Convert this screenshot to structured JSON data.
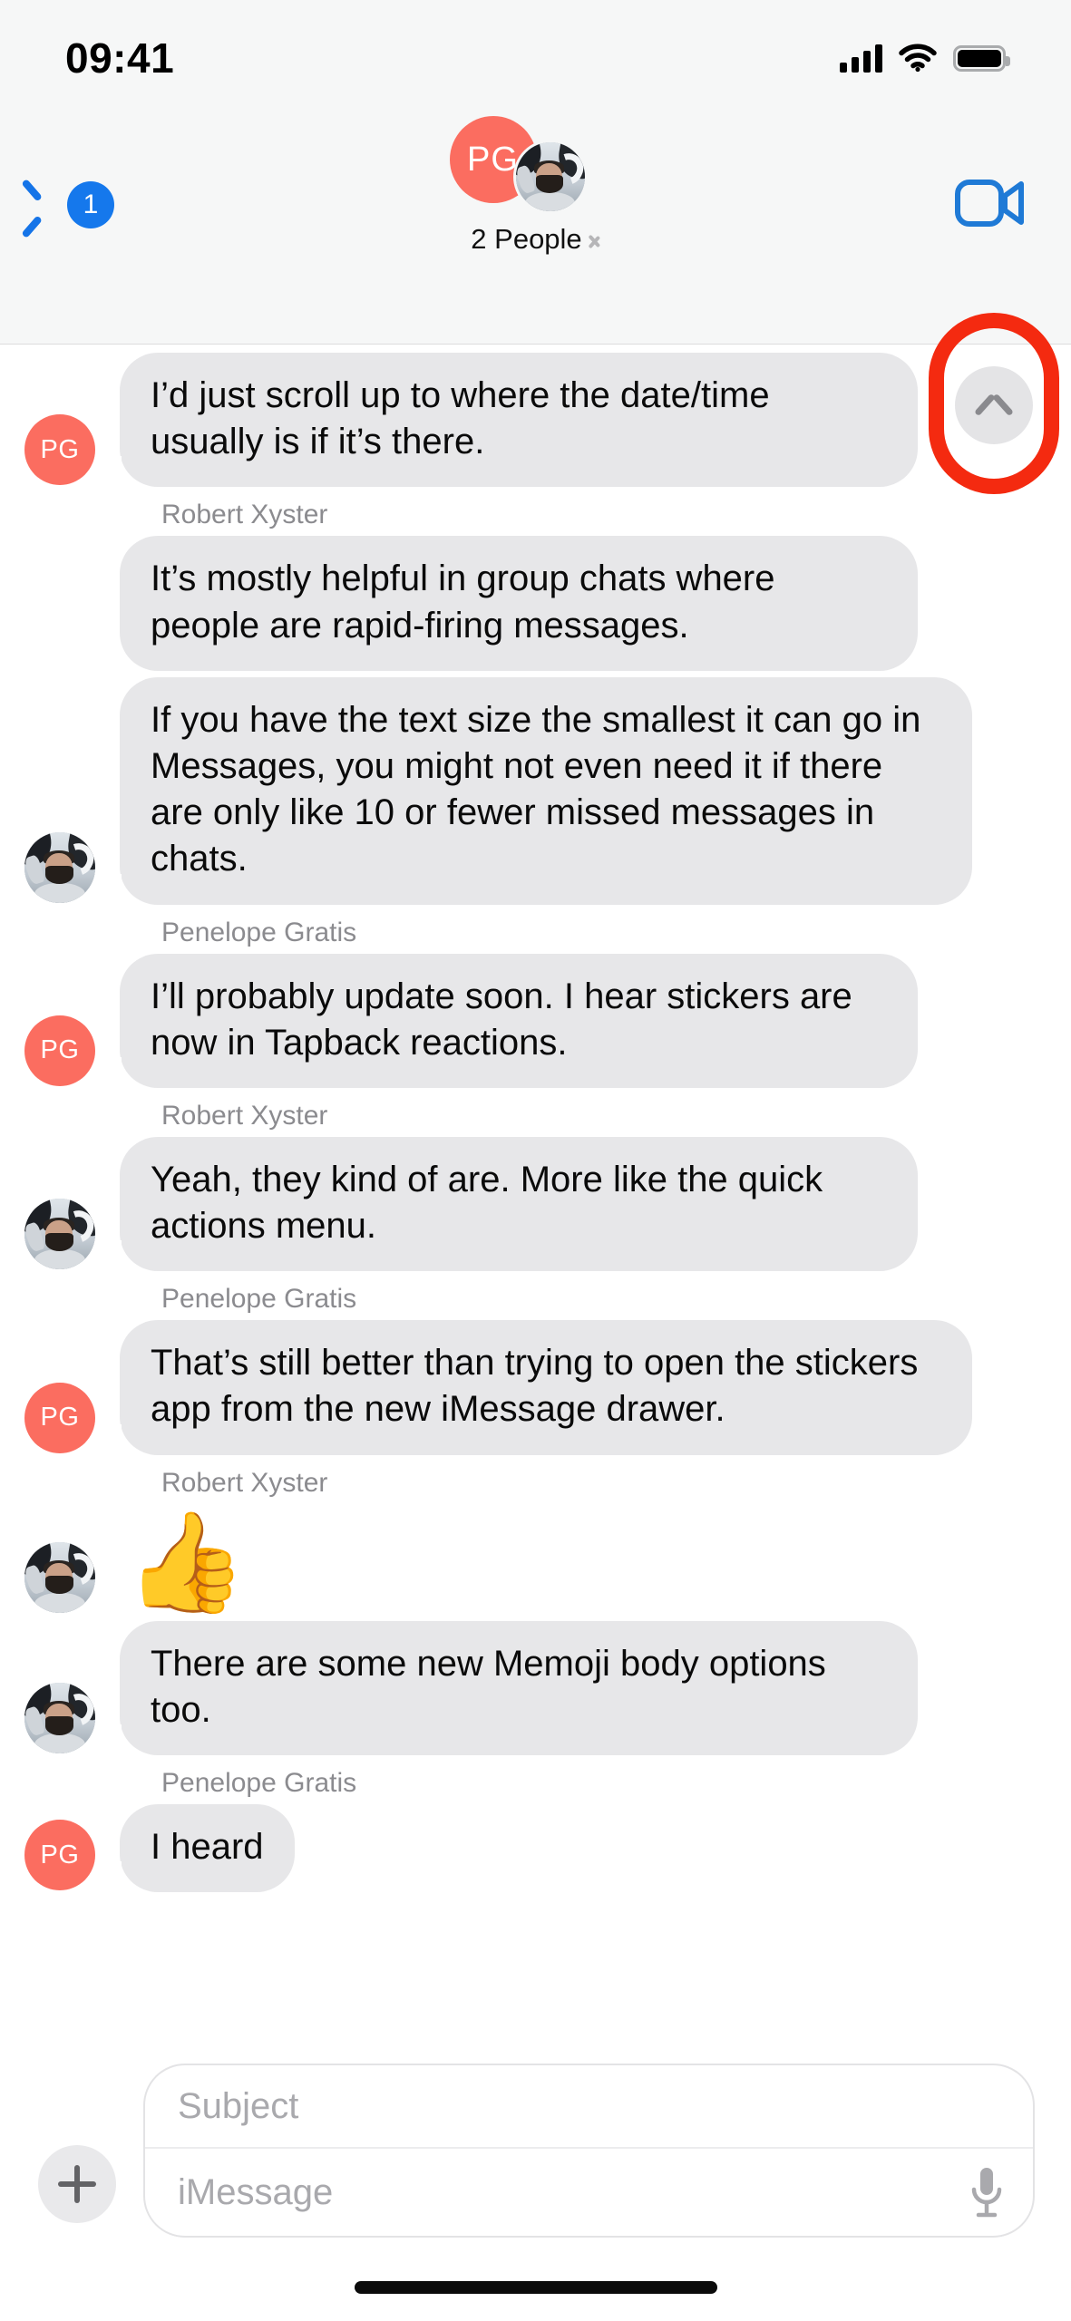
{
  "status_bar": {
    "time": "09:41",
    "cellular_icon": "signal-bars-icon",
    "wifi_icon": "wifi-icon",
    "battery_icon": "battery-icon"
  },
  "nav_bar": {
    "back_icon": "chevron-left-icon",
    "unread_badge": "1",
    "avatar_initials": "PG",
    "avatar_photo_alt": "robert-xyster-photo",
    "participants_label": "2 People",
    "disclosure_icon": "chevron-right-icon",
    "facetime_icon": "video-camera-icon"
  },
  "scroll_button": {
    "icon": "chevron-up-icon",
    "annotation_color": "#f42a10",
    "annotation_shape": "rounded-rect-outline"
  },
  "messages": [
    {
      "sender_label": "",
      "avatar": "PG",
      "avatar_type": "initials",
      "text": "I’d just scroll up to where the date/time usually is if it’s there.",
      "tail": true,
      "kind": "text"
    },
    {
      "sender_label": "Robert Xyster",
      "avatar": "",
      "avatar_type": "blank",
      "text": "It’s mostly helpful in group chats where people are rapid-firing messages.",
      "tail": false,
      "kind": "text"
    },
    {
      "sender_label": "",
      "avatar": "photo",
      "avatar_type": "photo",
      "text": "If you have the text size the smallest it can go in Messages, you might not even need it if there are only like 10 or fewer missed messages in chats.",
      "tail": true,
      "kind": "text"
    },
    {
      "sender_label": "Penelope Gratis",
      "avatar": "PG",
      "avatar_type": "initials",
      "text": "I’ll probably update soon. I hear stickers are now in Tapback reactions.",
      "tail": true,
      "kind": "text"
    },
    {
      "sender_label": "Robert Xyster",
      "avatar": "photo",
      "avatar_type": "photo",
      "text": "Yeah, they kind of are. More like the quick actions menu.",
      "tail": true,
      "kind": "text"
    },
    {
      "sender_label": "Penelope Gratis",
      "avatar": "PG",
      "avatar_type": "initials",
      "text": "That’s still better than trying to open the stickers app from the new iMessage drawer.",
      "tail": true,
      "kind": "text"
    },
    {
      "sender_label": "Robert Xyster",
      "avatar": "photo",
      "avatar_type": "photo",
      "text": "👍",
      "tail": false,
      "kind": "emoji"
    },
    {
      "sender_label": "",
      "avatar": "photo",
      "avatar_type": "photo",
      "text": "There are some new Memoji body options too.",
      "tail": true,
      "kind": "text"
    },
    {
      "sender_label": "Penelope Gratis",
      "avatar": "PG",
      "avatar_type": "initials",
      "text": "I heard",
      "tail": true,
      "kind": "text"
    }
  ],
  "input_bar": {
    "plus_icon": "plus-icon",
    "subject_placeholder": "Subject",
    "message_placeholder": "iMessage",
    "mic_icon": "microphone-icon"
  },
  "colors": {
    "accent_blue": "#1578ec",
    "avatar_red": "#fb6d60",
    "bubble_gray": "#e7e7e9",
    "annotation_red": "#f42a10"
  }
}
